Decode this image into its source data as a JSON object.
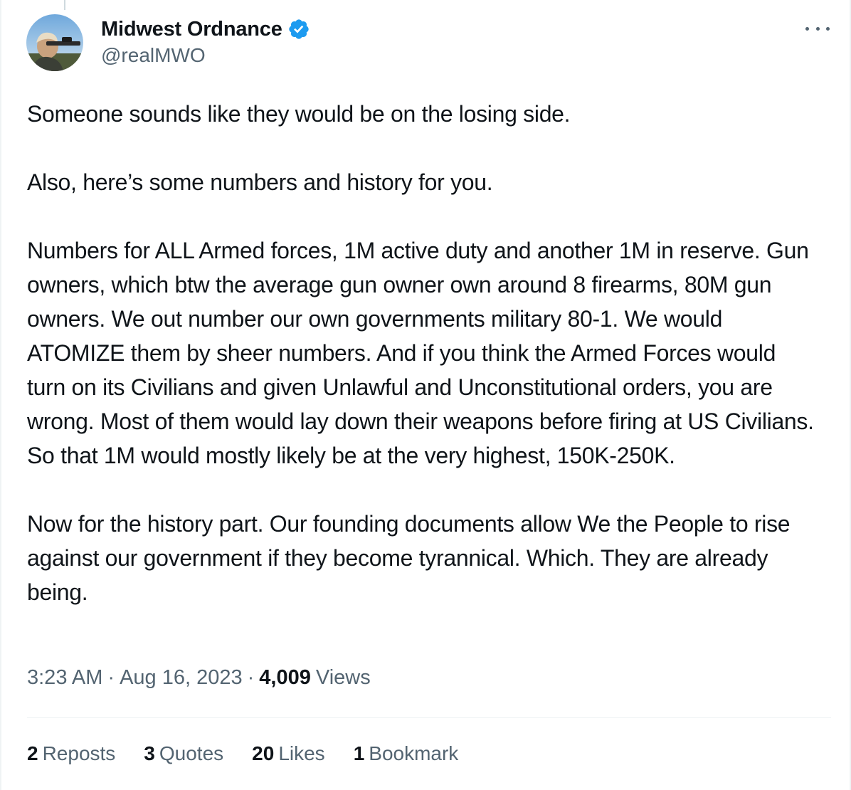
{
  "author": {
    "display_name": "Midwest Ordnance",
    "handle": "@realMWO",
    "verified_icon": "verified-badge-icon",
    "verified_color": "#1d9bf0"
  },
  "tweet": {
    "paragraphs": [
      "Someone sounds like they would be on the losing side.",
      "Also, here’s some numbers and history for you.",
      "Numbers for ALL Armed forces, 1M active duty and another 1M in reserve. Gun owners, which btw the average gun owner own around 8 firearms, 80M gun owners. We out number our own governments military 80-1. We would ATOMIZE them by sheer numbers. And if you think the Armed Forces would turn on its Civilians and given Unlawful and Unconstitutional orders, you are wrong. Most of them would lay down their weapons before firing at US Civilians. So that 1M would mostly likely be at the very highest, 150K-250K.",
      "Now for the history part. Our founding documents allow We the People to rise against our government if they become tyrannical. Which. They are already being."
    ]
  },
  "meta": {
    "time": "3:23 AM",
    "separator": "·",
    "date": "Aug 16, 2023",
    "views_count": "4,009",
    "views_label": "Views"
  },
  "stats": {
    "reposts_count": "2",
    "reposts_label": "Reposts",
    "quotes_count": "3",
    "quotes_label": "Quotes",
    "likes_count": "20",
    "likes_label": "Likes",
    "bookmarks_count": "1",
    "bookmarks_label": "Bookmark"
  },
  "colors": {
    "text_primary": "#0f1419",
    "text_secondary": "#536471",
    "border": "#eff3f4"
  }
}
